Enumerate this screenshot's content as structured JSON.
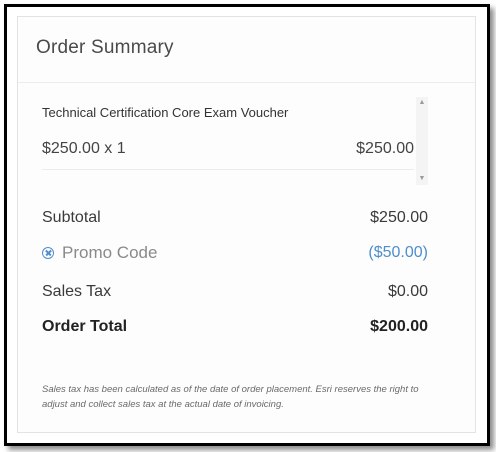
{
  "summary": {
    "title": "Order Summary",
    "items": [
      {
        "name": "Technical Certification Core Exam Voucher",
        "quantity_text": "$250.00 x 1",
        "price": "$250.00"
      }
    ],
    "scroll": {
      "up_glyph": "▲",
      "down_glyph": "▼"
    },
    "subtotal": {
      "label": "Subtotal",
      "value": "$250.00"
    },
    "promo": {
      "label": "Promo Code",
      "value": "($50.00)",
      "icon": "remove-circle-icon"
    },
    "sales_tax": {
      "label": "Sales Tax",
      "value": "$0.00"
    },
    "order_total": {
      "label": "Order Total",
      "value": "$200.00"
    },
    "footnote": "Sales tax has been calculated as of the date of order placement. Esri reserves the right to adjust and collect sales tax at the actual date of invoicing."
  },
  "colors": {
    "accent": "#4e8ecb",
    "border": "#000000"
  }
}
